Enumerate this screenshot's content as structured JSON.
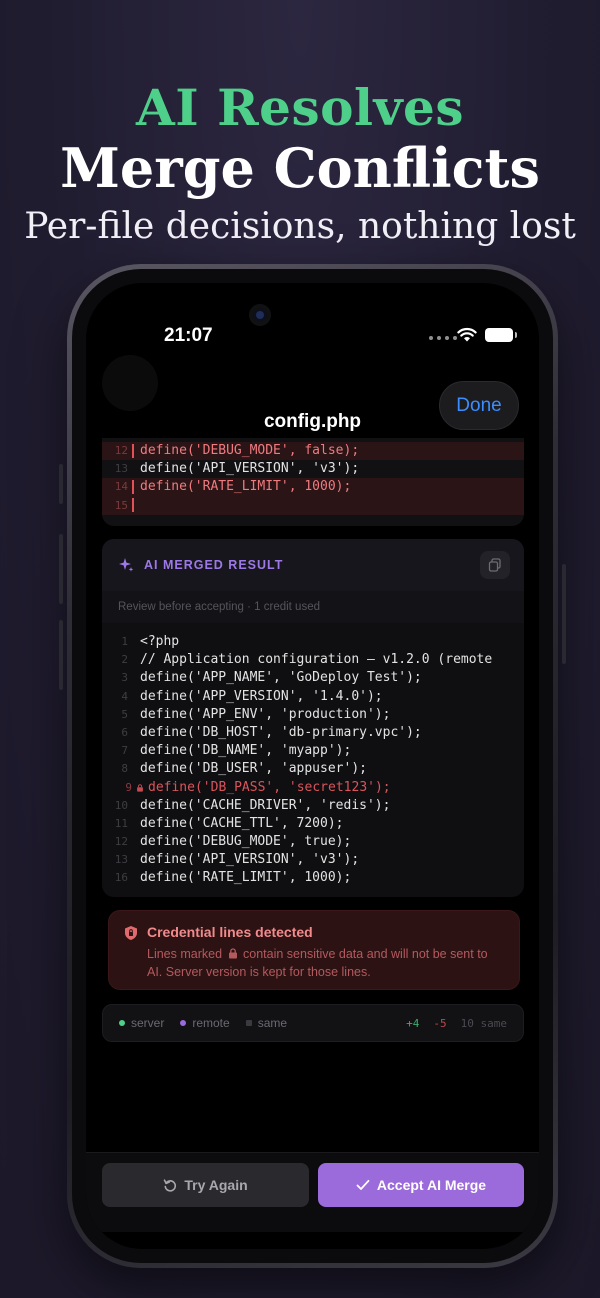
{
  "promo": {
    "headline_accent": "AI Resolves",
    "headline_main": "Merge Conflicts",
    "subheadline": "Per-file decisions, nothing lost"
  },
  "status_bar": {
    "time": "21:07"
  },
  "nav": {
    "title": "config.php",
    "done_label": "Done"
  },
  "conflict_preview": {
    "lines": [
      {
        "num": "12",
        "text": "define('DEBUG_MODE', false);",
        "kind": "removed"
      },
      {
        "num": "13",
        "text": "define('API_VERSION', 'v3');",
        "kind": "same"
      },
      {
        "num": "14",
        "text": "define('RATE_LIMIT', 1000);",
        "kind": "removed"
      },
      {
        "num": "15",
        "text": "",
        "kind": "removed"
      }
    ]
  },
  "ai_result": {
    "title": "AI MERGED RESULT",
    "subtitle": "Review before accepting · 1 credit used",
    "lines": [
      {
        "num": "1",
        "text": "<?php"
      },
      {
        "num": "2",
        "text": "// Application configuration — v1.2.0 (remote"
      },
      {
        "num": "3",
        "text": "define('APP_NAME', 'GoDeploy Test');"
      },
      {
        "num": "4",
        "text": "define('APP_VERSION', '1.4.0');"
      },
      {
        "num": "5",
        "text": "define('APP_ENV', 'production');"
      },
      {
        "num": "6",
        "text": "define('DB_HOST', 'db-primary.vpc');"
      },
      {
        "num": "7",
        "text": "define('DB_NAME', 'myapp');"
      },
      {
        "num": "8",
        "text": "define('DB_USER', 'appuser');"
      },
      {
        "num": "9",
        "text": "define('DB_PASS', 'secret123');",
        "credential": true
      },
      {
        "num": "10",
        "text": "define('CACHE_DRIVER', 'redis');"
      },
      {
        "num": "11",
        "text": "define('CACHE_TTL', 7200);"
      },
      {
        "num": "12",
        "text": "define('DEBUG_MODE', true);"
      },
      {
        "num": "13",
        "text": "define('API_VERSION', 'v3');"
      },
      {
        "num": "16",
        "text": "define('RATE_LIMIT', 1000);"
      }
    ]
  },
  "alert": {
    "title": "Credential lines detected",
    "body_before": "Lines marked",
    "body_after": "contain sensitive data and will not be sent to AI. Server version is kept for those lines."
  },
  "legend": {
    "server": "server",
    "remote": "remote",
    "same": "same",
    "added": "+4",
    "removed": "-5",
    "same_count": "10 same"
  },
  "actions": {
    "try_again": "Try Again",
    "accept": "Accept AI Merge"
  },
  "colors": {
    "accent_green": "#4fd08a",
    "accent_purple": "#9b6adb",
    "link_blue": "#3b8cff",
    "danger_red": "#e05257"
  }
}
